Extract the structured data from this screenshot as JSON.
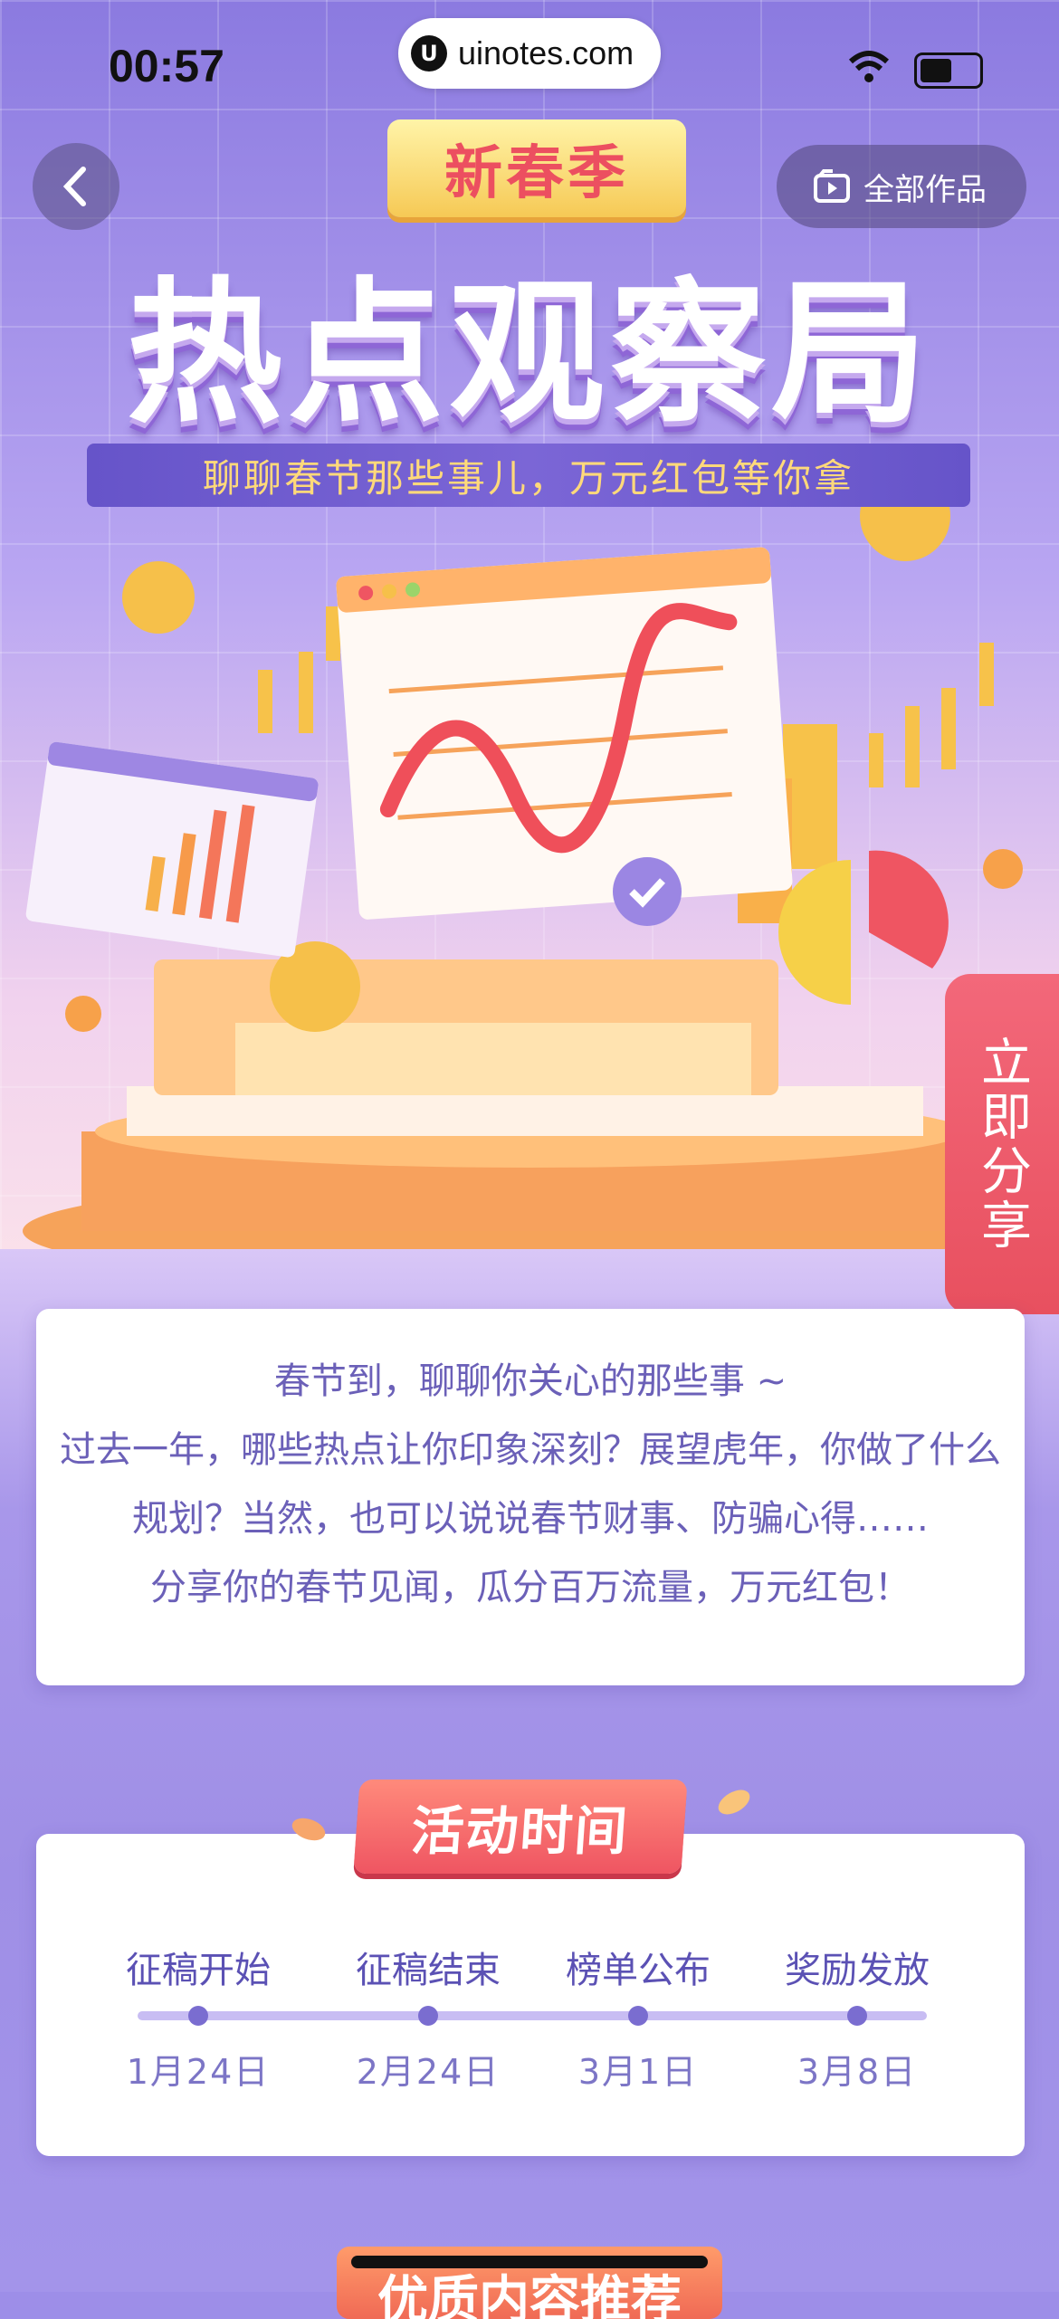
{
  "status_bar": {
    "time": "00:57",
    "url": "uinotes.com"
  },
  "nav": {
    "all_works_label": "全部作品"
  },
  "hero": {
    "tag": "新春季",
    "title": "热点观察局",
    "subtitle": "聊聊春节那些事儿，万元红包等你拿"
  },
  "share_tab": {
    "label": "立即分享"
  },
  "intro": {
    "lines": [
      "春节到，聊聊你关心的那些事 ~",
      "过去一年，哪些热点让你印象深刻？展望虎年，你做了什么",
      "规划？当然，也可以说说春节财事、防骗心得……",
      "分享你的春节见闻，瓜分百万流量，万元红包！"
    ]
  },
  "schedule": {
    "heading": "活动时间",
    "steps": [
      {
        "title": "征稿开始",
        "date": "1月24日"
      },
      {
        "title": "征稿结束",
        "date": "2月24日"
      },
      {
        "title": "榜单公布",
        "date": "3月1日"
      },
      {
        "title": "奖励发放",
        "date": "3月8日"
      }
    ]
  },
  "next_section": {
    "heading": "优质内容推荐"
  },
  "colors": {
    "accent_red": "#ef5562",
    "purple": "#6654c9",
    "gold": "#ffd97a"
  }
}
